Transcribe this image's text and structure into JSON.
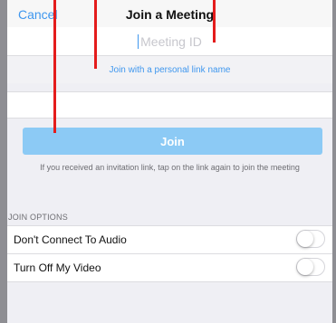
{
  "nav": {
    "cancel_label": "Cancel",
    "title": "Join a Meeting"
  },
  "meeting_id": {
    "placeholder": "Meeting ID"
  },
  "personal_link_label": "Join with a personal link name",
  "join_button_label": "Join",
  "invite_note": "If you received an invitation link, tap on the link again to join the meeting",
  "join_options": {
    "header": "JOIN OPTIONS",
    "items": [
      {
        "label": "Don't Connect To Audio",
        "enabled": false
      },
      {
        "label": "Turn Off My Video",
        "enabled": false
      }
    ]
  },
  "colors": {
    "accent": "#3f97ee",
    "join_button": "#8ccaf5",
    "annotation": "#e41c1c"
  }
}
